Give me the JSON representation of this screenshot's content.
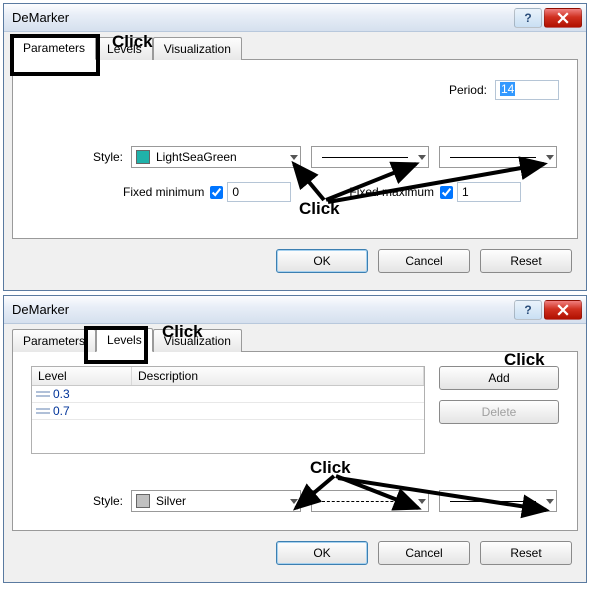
{
  "dlg1": {
    "title": "DeMarker",
    "tabs": {
      "parameters": "Parameters",
      "levels": "Levels",
      "visualization": "Visualization"
    },
    "period_label": "Period:",
    "period_value": "14",
    "style_label": "Style:",
    "style_color_name": "LightSeaGreen",
    "style_color_hex": "#20b2aa",
    "fixed_min_label": "Fixed minimum",
    "fixed_min_checked": true,
    "fixed_min_value": "0",
    "fixed_max_label": "Fixed maximum",
    "fixed_max_checked": true,
    "fixed_max_value": "1",
    "buttons": {
      "ok": "OK",
      "cancel": "Cancel",
      "reset": "Reset"
    },
    "annot_tab": "Click",
    "annot_dropdowns": "Click"
  },
  "dlg2": {
    "title": "DeMarker",
    "tabs": {
      "parameters": "Parameters",
      "levels": "Levels",
      "visualization": "Visualization"
    },
    "grid_headers": {
      "level": "Level",
      "description": "Description"
    },
    "levels": [
      {
        "value": "0.3",
        "description": ""
      },
      {
        "value": "0.7",
        "description": ""
      }
    ],
    "add_label": "Add",
    "delete_label": "Delete",
    "style_label": "Style:",
    "style_color_name": "Silver",
    "style_color_hex": "#c0c0c0",
    "buttons": {
      "ok": "OK",
      "cancel": "Cancel",
      "reset": "Reset"
    },
    "annot_tab": "Click",
    "annot_add": "Click",
    "annot_dropdowns": "Click"
  },
  "titlebar": {
    "help_glyph": "?",
    "close_glyph": "✕"
  }
}
